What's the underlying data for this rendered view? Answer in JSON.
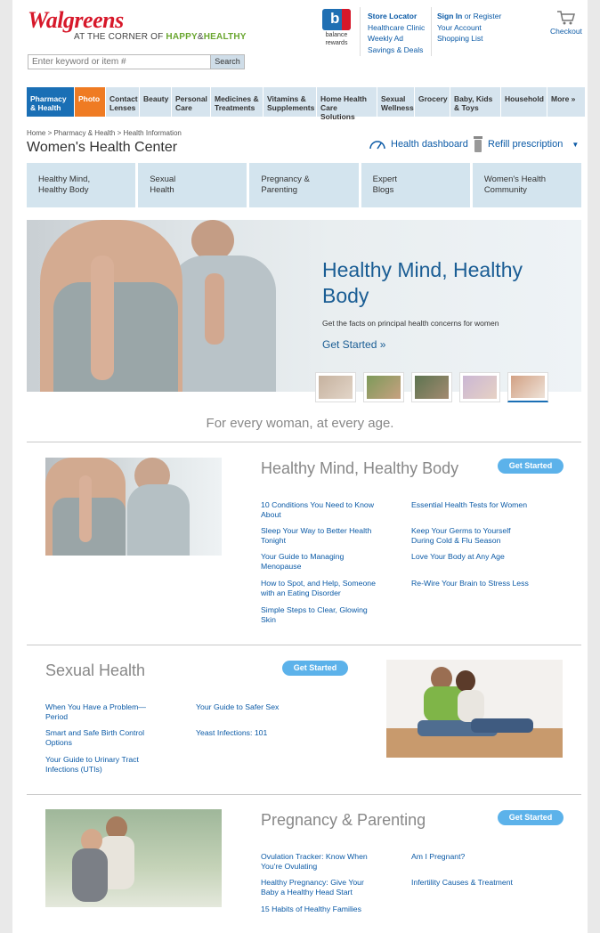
{
  "header": {
    "brand": "Walgreens",
    "tagline_pre": "AT THE CORNER OF ",
    "tagline_happy": "HAPPY",
    "tagline_amp": "&",
    "tagline_healthy": "HEALTHY",
    "search_placeholder": "Enter keyword or item #",
    "search_button": "Search",
    "balance_line1": "balance",
    "balance_line2": "rewards",
    "util_col1": [
      "Store Locator",
      "Healthcare Clinic",
      "Weekly Ad",
      "Savings & Deals"
    ],
    "sign_in": "Sign In",
    "or_register": " or Register",
    "util_col2_rest": [
      "Your Account",
      "Shopping List"
    ],
    "checkout": "Checkout"
  },
  "nav": [
    {
      "l1": "Pharmacy",
      "l2": "& Health"
    },
    {
      "l1": "Photo",
      "l2": ""
    },
    {
      "l1": "Contact",
      "l2": "Lenses"
    },
    {
      "l1": "Beauty",
      "l2": ""
    },
    {
      "l1": "Personal",
      "l2": "Care"
    },
    {
      "l1": "Medicines &",
      "l2": "Treatments"
    },
    {
      "l1": "Vitamins &",
      "l2": "Supplements"
    },
    {
      "l1": "Home Health",
      "l2": "Care Solutions"
    },
    {
      "l1": "Sexual",
      "l2": "Wellness"
    },
    {
      "l1": "Grocery",
      "l2": ""
    },
    {
      "l1": "Baby, Kids",
      "l2": "& Toys"
    },
    {
      "l1": "Household",
      "l2": ""
    },
    {
      "l1": "More »",
      "l2": ""
    }
  ],
  "breadcrumb": "Home > Pharmacy & Health > Health Information",
  "page_title": "Women's Health Center",
  "health_dashboard": "Health dashboard",
  "refill": "Refill prescription",
  "subnav": [
    {
      "l1": "Healthy Mind,",
      "l2": "Healthy Body"
    },
    {
      "l1": "Sexual",
      "l2": "Health"
    },
    {
      "l1": "Pregnancy &",
      "l2": "Parenting"
    },
    {
      "l1": "Expert",
      "l2": "Blogs"
    },
    {
      "l1": "Women's Health",
      "l2": "Community"
    }
  ],
  "hero": {
    "title_l1": "Healthy Mind, Healthy",
    "title_l2": "Body",
    "subtitle": "Get the facts on principal health concerns for women",
    "cta": "Get Started »"
  },
  "tagline": "For every woman, at every age.",
  "sections": {
    "mind": {
      "title": "Healthy Mind, Healthy Body",
      "cta": "Get Started",
      "left": [
        {
          "l1": "10 Conditions You Need to Know",
          "l2": "About"
        },
        {
          "l1": "Sleep Your Way to Better Health",
          "l2": "Tonight"
        },
        {
          "l1": "Your Guide to Managing",
          "l2": "Menopause"
        },
        {
          "l1": "How to Spot, and Help, Someone",
          "l2": "with an Eating Disorder"
        },
        {
          "l1": "Simple Steps to Clear, Glowing",
          "l2": "Skin"
        }
      ],
      "right": [
        {
          "l1": "Essential Health Tests for Women",
          "l2": ""
        },
        {
          "l1": "Keep Your Germs to Yourself",
          "l2": "During Cold & Flu Season"
        },
        {
          "l1": "Love Your Body at Any Age",
          "l2": ""
        },
        {
          "l1": "Re-Wire Your Brain to Stress Less",
          "l2": ""
        }
      ]
    },
    "sexual": {
      "title": "Sexual Health",
      "cta": "Get Started",
      "left": [
        {
          "l1": "When You Have a Problem—",
          "l2": "Period"
        },
        {
          "l1": "Smart and Safe Birth Control",
          "l2": "Options"
        },
        {
          "l1": "Your Guide to Urinary Tract",
          "l2": "Infections (UTIs)"
        }
      ],
      "right": [
        {
          "l1": "Your Guide to Safer Sex",
          "l2": ""
        },
        {
          "l1": "Yeast Infections: 101",
          "l2": ""
        }
      ]
    },
    "pregnancy": {
      "title": "Pregnancy & Parenting",
      "cta": "Get Started",
      "left": [
        {
          "l1": "Ovulation Tracker: Know When",
          "l2": "You're Ovulating"
        },
        {
          "l1": "Healthy Pregnancy: Give Your",
          "l2": "Baby a Healthy Head Start"
        },
        {
          "l1": "15 Habits of Healthy Families",
          "l2": ""
        }
      ],
      "right": [
        {
          "l1": "Am I Pregnant?",
          "l2": ""
        },
        {
          "l1": "Infertility Causes & Treatment",
          "l2": ""
        }
      ]
    }
  }
}
